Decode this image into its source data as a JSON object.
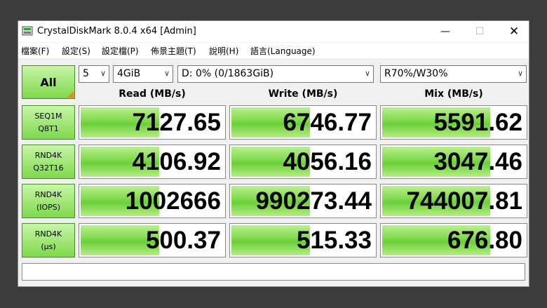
{
  "window": {
    "title": "CrystalDiskMark 8.0.4 x64 [Admin]",
    "controls": {
      "minimize": "—",
      "maximize": "☐",
      "close": "✕"
    }
  },
  "menu": [
    "檔案(F)",
    "設定(S)",
    "設定檔(P)",
    "佈景主題(T)",
    "說明(H)",
    "語言(Language)"
  ],
  "toolbar": {
    "all_label": "All",
    "count": "5",
    "size": "4GiB",
    "drive": "D: 0% (0/1863GiB)",
    "mix": "R70%/W30%"
  },
  "columns": [
    "Read (MB/s)",
    "Write (MB/s)",
    "Mix (MB/s)"
  ],
  "rows": [
    {
      "label1": "SEQ1M",
      "label2": "Q8T1",
      "values": [
        "7127.65",
        "6746.77",
        "5591.62"
      ]
    },
    {
      "label1": "RND4K",
      "label2": "Q32T16",
      "values": [
        "4106.92",
        "4056.16",
        "3047.46"
      ]
    },
    {
      "label1": "RND4K",
      "label2": "(IOPS)",
      "values": [
        "1002666",
        "990273.44",
        "744007.81"
      ]
    },
    {
      "label1": "RND4K",
      "label2": "(μs)",
      "values": [
        "500.37",
        "515.33",
        "676.80"
      ]
    }
  ],
  "bar_fill_fraction": [
    [
      0.56,
      0.56,
      0.76
    ],
    [
      0.56,
      0.56,
      0.76
    ],
    [
      0.56,
      0.56,
      0.76
    ],
    [
      0.56,
      0.56,
      0.76
    ]
  ],
  "status_text": ""
}
